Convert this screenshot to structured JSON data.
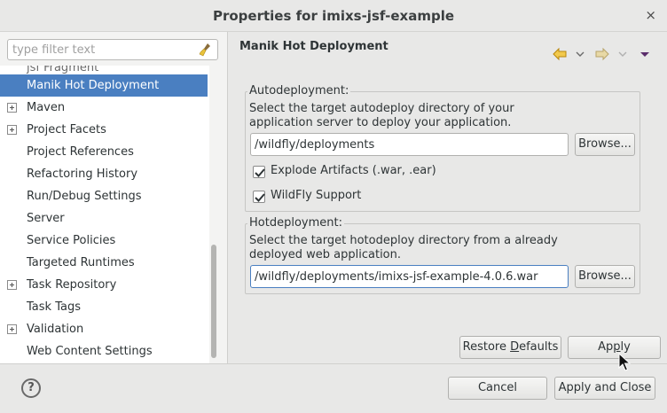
{
  "window": {
    "title": "Properties for imixs-jsf-example",
    "close_glyph": "×"
  },
  "filter": {
    "placeholder": "type filter text",
    "value": ""
  },
  "tree": {
    "partial_item": "jsf Fragment",
    "items": [
      {
        "label": "Manik Hot Deployment",
        "expandable": false,
        "selected": true
      },
      {
        "label": "Maven",
        "expandable": true,
        "selected": false
      },
      {
        "label": "Project Facets",
        "expandable": true,
        "selected": false
      },
      {
        "label": "Project References",
        "expandable": false,
        "selected": false
      },
      {
        "label": "Refactoring History",
        "expandable": false,
        "selected": false
      },
      {
        "label": "Run/Debug Settings",
        "expandable": false,
        "selected": false
      },
      {
        "label": "Server",
        "expandable": false,
        "selected": false
      },
      {
        "label": "Service Policies",
        "expandable": false,
        "selected": false
      },
      {
        "label": "Targeted Runtimes",
        "expandable": false,
        "selected": false
      },
      {
        "label": "Task Repository",
        "expandable": true,
        "selected": false
      },
      {
        "label": "Task Tags",
        "expandable": false,
        "selected": false
      },
      {
        "label": "Validation",
        "expandable": true,
        "selected": false
      },
      {
        "label": "Web Content Settings",
        "expandable": false,
        "selected": false
      }
    ]
  },
  "page": {
    "title": "Manik Hot Deployment",
    "nav": {
      "back_icon": "arrow-left-icon",
      "forward_icon": "arrow-right-icon",
      "menu_icon": "triangle-down-icon",
      "accent_color": "#e8a317"
    }
  },
  "autodeploy": {
    "legend": "Autodeployment:",
    "desc_line1": "Select the target autodeploy directory of your",
    "desc_line2": "application server to deploy your application.",
    "path": "/wildfly/deployments",
    "browse_label": "Browse...",
    "explode_label": "Explode Artifacts (.war, .ear)",
    "explode_checked": true,
    "wildfly_label": "WildFly Support",
    "wildfly_checked": true
  },
  "hotdeploy": {
    "legend": "Hotdeployment:",
    "desc_line1": "Select the target hotodeploy directory from a already",
    "desc_line2": "deployed web application.",
    "path": "/wildfly/deployments/imixs-jsf-example-4.0.6.war",
    "browse_label": "Browse..."
  },
  "actions": {
    "restore_defaults": "Restore Defaults",
    "apply": "Apply",
    "cancel": "Cancel",
    "apply_close": "Apply and Close",
    "help_glyph": "?"
  }
}
